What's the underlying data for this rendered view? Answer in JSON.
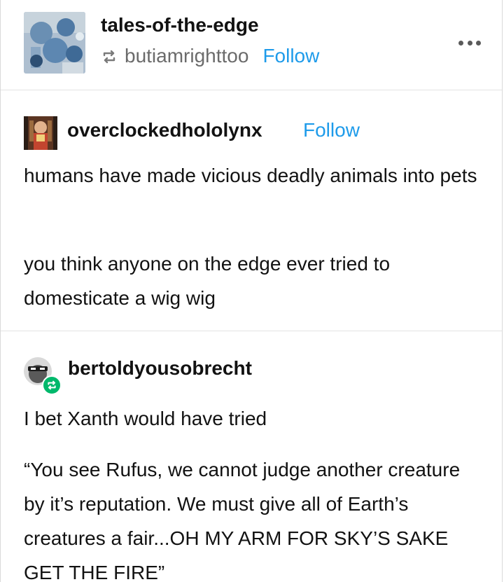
{
  "post": {
    "blog_name": "tales-of-the-edge",
    "reblogged_from": "butiamrighttoo",
    "follow_label": "Follow",
    "more_icon": "ellipsis-icon",
    "reblog_icon": "reblog-icon"
  },
  "trail": [
    {
      "username": "overclockedhololynx",
      "follow_label": "Follow",
      "paragraphs": [
        "humans have made vicious deadly animals into pets",
        "you think anyone on the edge ever tried to domesticate a wig wig"
      ]
    },
    {
      "username": "bertoldyousobrecht",
      "badge_icon": "reblog-badge-icon",
      "paragraphs": [
        "I bet Xanth would have tried",
        "“You see Rufus, we cannot judge another creature by it’s reputation. We must give all of Earth’s creatures a fair...OH MY ARM FOR SKY’S SAKE GET THE FIRE”"
      ]
    }
  ],
  "colors": {
    "text": "#121212",
    "secondary": "#6b6b6b",
    "link": "#1e9bea",
    "badge": "#00b86b",
    "divider": "#e4e4e4"
  }
}
